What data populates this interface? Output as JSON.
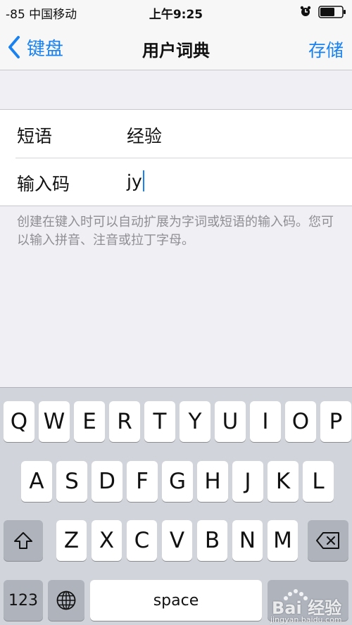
{
  "status_bar": {
    "carrier": "-85 中国移动",
    "time": "上午9:25"
  },
  "nav": {
    "back_label": "键盘",
    "title": "用户词典",
    "save_label": "存储"
  },
  "form": {
    "phrase_label": "短语",
    "phrase_value": "经验",
    "shortcut_label": "输入码",
    "shortcut_value": "jy"
  },
  "hint": "创建在键入时可以自动扩展为字词或短语的输入码。您可以输入拼音、注音或拉丁字母。",
  "keyboard": {
    "row1": [
      "Q",
      "W",
      "E",
      "R",
      "T",
      "Y",
      "U",
      "I",
      "O",
      "P"
    ],
    "row2": [
      "A",
      "S",
      "D",
      "F",
      "G",
      "H",
      "J",
      "K",
      "L"
    ],
    "row3": [
      "Z",
      "X",
      "C",
      "V",
      "B",
      "N",
      "M"
    ],
    "numbers_label": "123",
    "space_label": "space"
  },
  "watermark": {
    "text": "Bai 经验",
    "subtext": "jingyan.baidu.com"
  },
  "colors": {
    "accent": "#1a82f0",
    "background": "#efeff4",
    "keyboard_bg": "#d1d5db"
  }
}
